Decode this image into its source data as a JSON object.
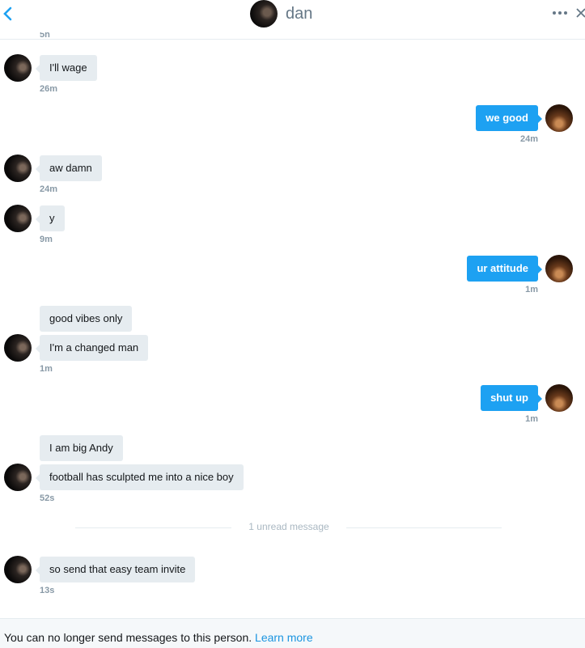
{
  "header": {
    "contact_name": "dan"
  },
  "top_cut_timestamp": "5h",
  "messages": [
    {
      "text": "I'll wage",
      "time": "26m"
    },
    {
      "text": "we good",
      "time": "24m"
    },
    {
      "text": "aw damn",
      "time": "24m"
    },
    {
      "text": "y",
      "time": "9m"
    },
    {
      "text": "ur attitude",
      "time": "1m"
    },
    {
      "text": "good vibes only"
    },
    {
      "text": "I'm a changed man",
      "time": "1m"
    },
    {
      "text": "shut up",
      "time": "1m"
    },
    {
      "text": "I am big Andy"
    },
    {
      "text": "football has sculpted me into a nice boy",
      "time": "52s"
    },
    {
      "text": "so send that easy team invite",
      "time": "13s"
    }
  ],
  "unread_divider": "1 unread message",
  "footer": {
    "notice": "You can no longer send messages to this person.",
    "link": "Learn more"
  },
  "colors": {
    "outgoing": "#1da1f2",
    "incoming": "#e6ecf0",
    "link": "#1b95e0"
  },
  "icons": [
    "back-icon",
    "more-icon",
    "close-icon"
  ]
}
